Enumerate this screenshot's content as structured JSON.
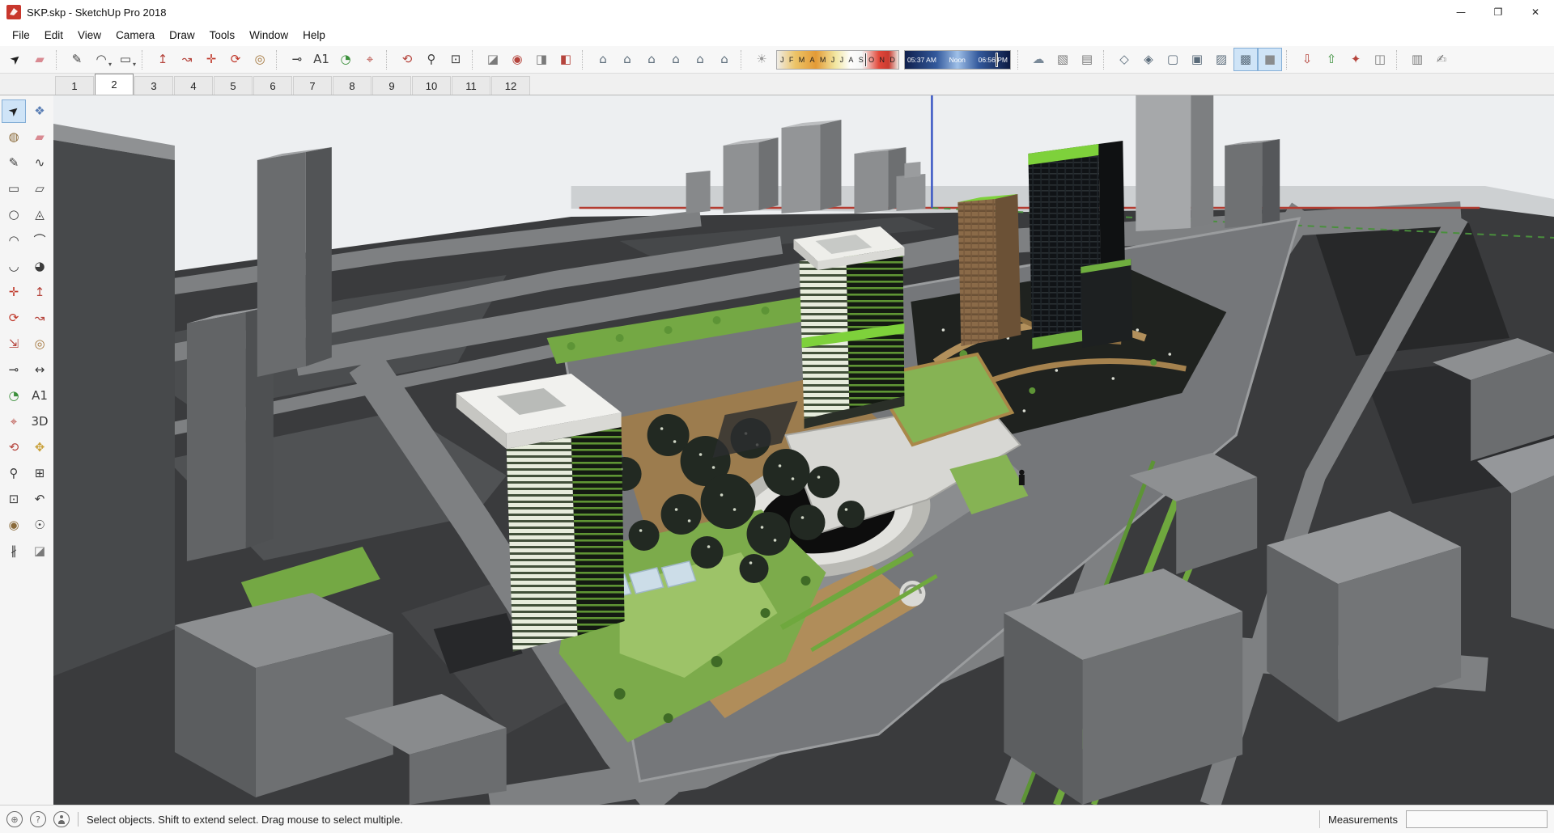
{
  "window": {
    "title": "SKP.skp - SketchUp Pro 2018",
    "controls": {
      "minimize": "—",
      "maximize": "❐",
      "close": "✕"
    }
  },
  "menu_bar": {
    "items": [
      "File",
      "Edit",
      "View",
      "Camera",
      "Draw",
      "Tools",
      "Window",
      "Help"
    ]
  },
  "toolbar": {
    "items": [
      {
        "name": "select-tool",
        "glyph": "➤",
        "color": "#1f1f1f",
        "rotate": -40
      },
      {
        "name": "eraser-tool",
        "glyph": "▰",
        "color": "#d98a92"
      },
      {
        "type": "sep"
      },
      {
        "name": "line-tool",
        "glyph": "✎",
        "color": "#3c3c3c"
      },
      {
        "name": "arcs-tool",
        "glyph": "◠",
        "color": "#3c3c3c",
        "dropdown": true
      },
      {
        "name": "shapes-tool",
        "glyph": "▭",
        "color": "#3c3c3c",
        "dropdown": true
      },
      {
        "type": "sep"
      },
      {
        "name": "push-pull-tool",
        "glyph": "↥",
        "color": "#b5443c"
      },
      {
        "name": "follow-me-tool",
        "glyph": "↝",
        "color": "#b5443c"
      },
      {
        "name": "move-tool",
        "glyph": "✛",
        "color": "#c0392b"
      },
      {
        "name": "rotate-tool",
        "glyph": "⟳",
        "color": "#c0392b"
      },
      {
        "name": "offset-tool",
        "glyph": "◎",
        "color": "#a3763c"
      },
      {
        "type": "sep"
      },
      {
        "name": "tape-measure-tool",
        "glyph": "⊸",
        "color": "#3c3c3c"
      },
      {
        "name": "text-tool",
        "glyph": "A1",
        "color": "#3c3c3c"
      },
      {
        "name": "protractor-tool",
        "glyph": "◔",
        "color": "#3a8f3a"
      },
      {
        "name": "axes-tool",
        "glyph": "⌖",
        "color": "#b5443c"
      },
      {
        "type": "sep"
      },
      {
        "name": "orbit-tool",
        "glyph": "⟲",
        "color": "#b5443c"
      },
      {
        "name": "zoom-tool",
        "glyph": "⚲",
        "color": "#3c3c3c"
      },
      {
        "name": "zoom-extents-tool",
        "glyph": "⊡",
        "color": "#3c3c3c"
      },
      {
        "type": "sep"
      },
      {
        "name": "section-plane-tool",
        "glyph": "◪",
        "color": "#7a7a7a"
      },
      {
        "name": "display-section-cuts",
        "glyph": "◉",
        "color": "#b5443c"
      },
      {
        "name": "display-section-planes",
        "glyph": "◨",
        "color": "#7a7a7a"
      },
      {
        "name": "section-fill",
        "glyph": "◧",
        "color": "#b5443c"
      },
      {
        "type": "sep"
      },
      {
        "name": "iso-view",
        "glyph": "⌂",
        "color": "#5a6a78"
      },
      {
        "name": "top-view",
        "glyph": "⌂",
        "color": "#5a6a78"
      },
      {
        "name": "front-view",
        "glyph": "⌂",
        "color": "#5a6a78"
      },
      {
        "name": "right-view",
        "glyph": "⌂",
        "color": "#5a6a78"
      },
      {
        "name": "back-view",
        "glyph": "⌂",
        "color": "#5a6a78"
      },
      {
        "name": "left-view",
        "glyph": "⌂",
        "color": "#5a6a78"
      },
      {
        "type": "sep"
      },
      {
        "name": "shadows-toggle",
        "glyph": "☀",
        "color": "#9a9a9a"
      },
      {
        "type": "date-slider"
      },
      {
        "type": "time-slider"
      },
      {
        "type": "sep"
      },
      {
        "name": "fog-toggle",
        "glyph": "☁",
        "color": "#7a8a99"
      },
      {
        "name": "match-photo",
        "glyph": "▧",
        "color": "#7a7a7a"
      },
      {
        "name": "shadow-settings",
        "glyph": "▤",
        "color": "#7a7a7a"
      },
      {
        "type": "sep"
      },
      {
        "name": "style-xray",
        "glyph": "◇",
        "color": "#5a6b7a"
      },
      {
        "name": "style-back-edges",
        "glyph": "◈",
        "color": "#5a6b7a"
      },
      {
        "name": "style-wireframe",
        "glyph": "▢",
        "color": "#5a6b7a"
      },
      {
        "name": "style-hidden-line",
        "glyph": "▣",
        "color": "#5a6b7a"
      },
      {
        "name": "style-shaded",
        "glyph": "▨",
        "color": "#5a6b7a"
      },
      {
        "name": "style-shaded-textures",
        "glyph": "▩",
        "color": "#5a6b7a",
        "active": true
      },
      {
        "name": "style-monochrome",
        "glyph": "■",
        "color": "#8a8c8e",
        "active": true
      },
      {
        "type": "sep"
      },
      {
        "name": "get-models",
        "glyph": "⇩",
        "color": "#b5443c"
      },
      {
        "name": "share-model",
        "glyph": "⇧",
        "color": "#3a8f3a"
      },
      {
        "name": "extension-warehouse",
        "glyph": "✦",
        "color": "#b5443c"
      },
      {
        "name": "send-to-layout",
        "glyph": "◫",
        "color": "#7a7a7a"
      },
      {
        "type": "sep"
      },
      {
        "name": "default-tray-toggle",
        "glyph": "▥",
        "color": "#7a7a7a"
      },
      {
        "name": "instructor",
        "glyph": "✍",
        "color": "#7a7a7a"
      }
    ],
    "shadow_date": {
      "months": [
        "J",
        "F",
        "M",
        "A",
        "M",
        "J",
        "J",
        "A",
        "S",
        "O",
        "N",
        "D"
      ],
      "position": 0.72
    },
    "shadow_time": {
      "start": "05:37 AM",
      "mid": "Noon",
      "end": "06:56 PM",
      "position": 0.86
    }
  },
  "scene_tabs": {
    "tabs": [
      "1",
      "2",
      "3",
      "4",
      "5",
      "6",
      "7",
      "8",
      "9",
      "10",
      "11",
      "12"
    ],
    "active_index": 1
  },
  "tool_palette": {
    "tools": [
      {
        "name": "select-tool",
        "glyph": "➤",
        "color": "#1f1f1f",
        "rotate": -40,
        "active": true
      },
      {
        "name": "make-component-tool",
        "glyph": "❖",
        "color": "#5b7fb5"
      },
      {
        "name": "paint-bucket-tool",
        "glyph": "◍",
        "color": "#8a6a3a"
      },
      {
        "name": "eraser-tool",
        "glyph": "▰",
        "color": "#d98a92"
      },
      {
        "name": "line-tool",
        "glyph": "✎",
        "color": "#3c3c3c"
      },
      {
        "name": "freehand-tool",
        "glyph": "∿",
        "color": "#3c3c3c"
      },
      {
        "name": "rectangle-tool",
        "glyph": "▭",
        "color": "#3c3c3c"
      },
      {
        "name": "rotated-rectangle-tool",
        "glyph": "▱",
        "color": "#3c3c3c"
      },
      {
        "name": "circle-tool",
        "glyph": "○",
        "color": "#3c3c3c"
      },
      {
        "name": "polygon-tool",
        "glyph": "◬",
        "color": "#3c3c3c"
      },
      {
        "name": "arc-tool",
        "glyph": "◠",
        "color": "#3c3c3c"
      },
      {
        "name": "two-point-arc-tool",
        "glyph": "⌒",
        "color": "#3c3c3c"
      },
      {
        "name": "three-point-arc-tool",
        "glyph": "◡",
        "color": "#3c3c3c"
      },
      {
        "name": "pie-tool",
        "glyph": "◕",
        "color": "#3c3c3c"
      },
      {
        "name": "move-tool",
        "glyph": "✛",
        "color": "#c0392b"
      },
      {
        "name": "push-pull-tool",
        "glyph": "↥",
        "color": "#b5443c"
      },
      {
        "name": "rotate-tool",
        "glyph": "⟳",
        "color": "#c0392b"
      },
      {
        "name": "follow-me-tool",
        "glyph": "↝",
        "color": "#b5443c"
      },
      {
        "name": "scale-tool",
        "glyph": "⇲",
        "color": "#b5443c"
      },
      {
        "name": "offset-tool",
        "glyph": "◎",
        "color": "#a3763c"
      },
      {
        "name": "tape-measure-tool",
        "glyph": "⊸",
        "color": "#3c3c3c"
      },
      {
        "name": "dimension-tool",
        "glyph": "↔",
        "color": "#3c3c3c"
      },
      {
        "name": "protractor-tool",
        "glyph": "◔",
        "color": "#3a8f3a"
      },
      {
        "name": "text-tool",
        "glyph": "A1",
        "color": "#3c3c3c"
      },
      {
        "name": "axes-tool",
        "glyph": "⌖",
        "color": "#b5443c"
      },
      {
        "name": "three-d-text-tool",
        "glyph": "3D",
        "color": "#3c3c3c"
      },
      {
        "name": "orbit-tool",
        "glyph": "⟲",
        "color": "#b5443c"
      },
      {
        "name": "pan-tool",
        "glyph": "✥",
        "color": "#c9a13b"
      },
      {
        "name": "zoom-tool",
        "glyph": "⚲",
        "color": "#3c3c3c"
      },
      {
        "name": "zoom-window-tool",
        "glyph": "⊞",
        "color": "#3c3c3c"
      },
      {
        "name": "zoom-extents-tool",
        "glyph": "⊡",
        "color": "#3c3c3c"
      },
      {
        "name": "previous-view-tool",
        "glyph": "↶",
        "color": "#3c3c3c"
      },
      {
        "name": "position-camera-tool",
        "glyph": "◉",
        "color": "#8a6a3a"
      },
      {
        "name": "look-around-tool",
        "glyph": "☉",
        "color": "#3c3c3c"
      },
      {
        "name": "walk-tool",
        "glyph": "∦",
        "color": "#3c3c3c"
      },
      {
        "name": "section-plane-tool",
        "glyph": "◪",
        "color": "#7a7a7a"
      }
    ]
  },
  "viewport": {
    "axes": {
      "x_color": "#b43c31",
      "y_color": "#4a8f3d",
      "z_color": "#3956c4"
    }
  },
  "status_bar": {
    "icons": [
      {
        "name": "geolocate-icon",
        "glyph": "⊕"
      },
      {
        "name": "help-icon",
        "glyph": "?"
      },
      {
        "name": "user-icon",
        "glyph": ""
      }
    ],
    "hint": "Select objects. Shift to extend select. Drag mouse to select multiple.",
    "measurements_label": "Measurements",
    "measurements_value": ""
  }
}
